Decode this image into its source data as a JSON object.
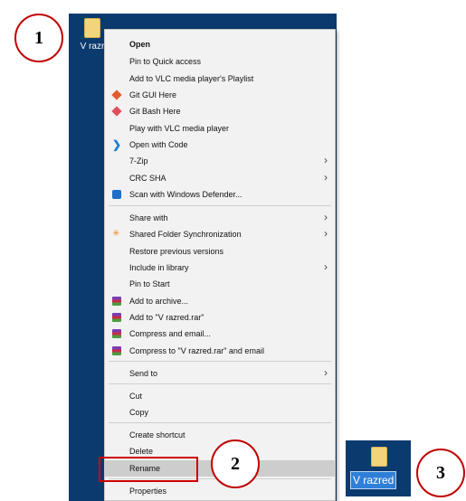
{
  "desktop": {
    "icon_label": "V razr",
    "inset_icon_label": "V razred"
  },
  "menu": {
    "items": [
      {
        "label": "Open",
        "icon": "",
        "arrow": false,
        "bold": true
      },
      {
        "label": "Pin to Quick access",
        "icon": "",
        "arrow": false
      },
      {
        "label": "Add to VLC media player's Playlist",
        "icon": "",
        "arrow": false
      },
      {
        "label": "Git GUI Here",
        "icon": "git-gui-icon",
        "arrow": false
      },
      {
        "label": "Git Bash Here",
        "icon": "git-bash-icon",
        "arrow": false
      },
      {
        "label": "Play with VLC media player",
        "icon": "",
        "arrow": false
      },
      {
        "label": "Open with Code",
        "icon": "vscode-icon",
        "arrow": false
      },
      {
        "label": "7-Zip",
        "icon": "",
        "arrow": true
      },
      {
        "label": "CRC SHA",
        "icon": "",
        "arrow": true
      },
      {
        "label": "Scan with Windows Defender...",
        "icon": "windows-defender-icon",
        "arrow": false
      },
      {
        "label": "Share with",
        "icon": "",
        "arrow": true
      },
      {
        "label": "Shared Folder Synchronization",
        "icon": "sync-icon",
        "arrow": true
      },
      {
        "label": "Restore previous versions",
        "icon": "",
        "arrow": false
      },
      {
        "label": "Include in library",
        "icon": "",
        "arrow": true
      },
      {
        "label": "Pin to Start",
        "icon": "",
        "arrow": false
      },
      {
        "label": "Add to archive...",
        "icon": "winrar-icon",
        "arrow": false
      },
      {
        "label": "Add to \"V razred.rar\"",
        "icon": "winrar-icon",
        "arrow": false
      },
      {
        "label": "Compress and email...",
        "icon": "winrar-icon",
        "arrow": false
      },
      {
        "label": "Compress to \"V razred.rar\" and email",
        "icon": "winrar-icon",
        "arrow": false
      },
      {
        "label": "Send to",
        "icon": "",
        "arrow": true
      },
      {
        "label": "Cut",
        "icon": "",
        "arrow": false
      },
      {
        "label": "Copy",
        "icon": "",
        "arrow": false
      },
      {
        "label": "Create shortcut",
        "icon": "",
        "arrow": false
      },
      {
        "label": "Delete",
        "icon": "",
        "arrow": false
      },
      {
        "label": "Rename",
        "icon": "",
        "arrow": false,
        "highlighted": true
      },
      {
        "label": "Properties",
        "icon": "",
        "arrow": false
      }
    ]
  },
  "callouts": {
    "step1": "1",
    "step2": "2",
    "step3": "3"
  },
  "colors": {
    "desktop_bg": "#0b3a6e",
    "menu_bg": "#f2f2f2",
    "callout_border": "#c00000",
    "rename_highlight": "#cc0000",
    "selection_blue": "#2f7fd9"
  }
}
